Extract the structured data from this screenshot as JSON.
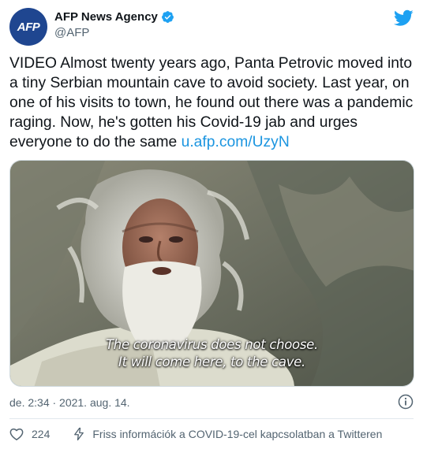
{
  "author": {
    "name": "AFP News Agency",
    "handle": "@AFP",
    "avatar_text": "AFP",
    "avatar_color": "#1f4690",
    "verified": true
  },
  "brand": {
    "logo": "twitter-bird-icon",
    "color": "#1da1f2"
  },
  "tweet": {
    "text": "VIDEO Almost twenty years ago, Panta Petrovic moved into a tiny Serbian mountain cave to avoid society. Last year, on one of his visits to town, he found out there was a pandemic raging. Now, he's gotten his Covid-19 jab and urges everyone to do the same ",
    "link": "u.afp.com/UzyN",
    "link_color": "#1b95e0"
  },
  "media": {
    "caption_line1": "The coronavirus does not choose.",
    "caption_line2": "It will come here, to the cave."
  },
  "meta": {
    "timestamp": "de. 2:34 · 2021. aug. 14."
  },
  "actions": {
    "like_count": "224",
    "covid_info_label": "Friss információk a COVID-19-cel kapcsolatban a Twitteren"
  }
}
